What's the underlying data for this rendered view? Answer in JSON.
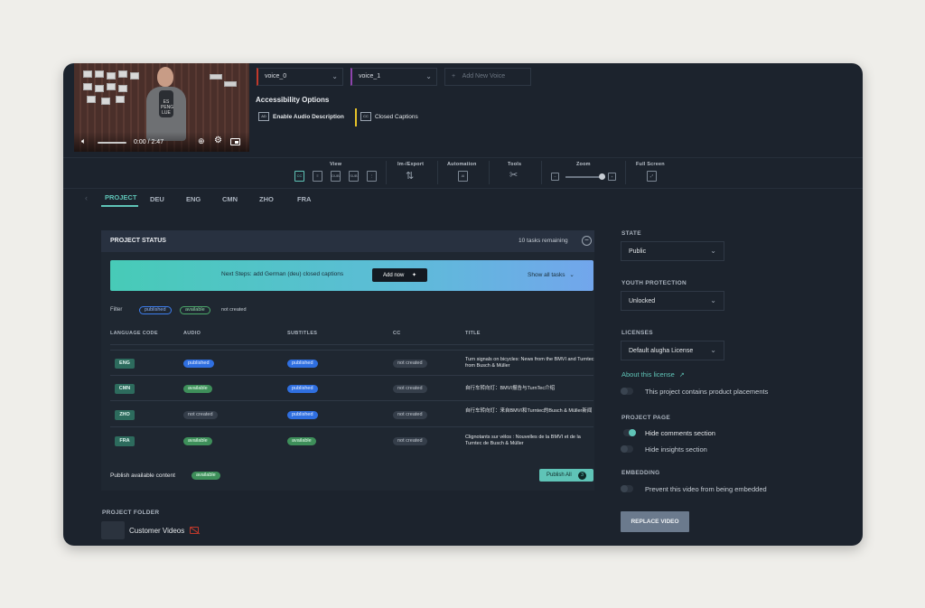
{
  "player": {
    "time": "0:00 / 2:47",
    "shirt_text": "ES\nPENG\nLUE"
  },
  "voices": {
    "voice_0": "voice_0",
    "voice_1": "voice_1",
    "add_new": "Add New Voice"
  },
  "accessibility": {
    "title": "Accessibility Options",
    "audio_desc_icon": "AD",
    "audio_desc": "Enable Audio Description",
    "cc_icon": "CC",
    "closed_captions": "Closed Captions"
  },
  "toolbar": {
    "view": "View",
    "export": "Im-/Export",
    "automation": "Automation",
    "tools": "Tools",
    "zoom": "Zoom",
    "fullscreen": "Full Screen",
    "view_icons": [
      "CC",
      "",
      "DUB",
      "SUB",
      ""
    ],
    "ai_icon": "AI",
    "zoom_level": 0.8
  },
  "tabs": [
    "PROJECT",
    "DEU",
    "ENG",
    "CMN",
    "ZHO",
    "FRA"
  ],
  "project_status": {
    "title": "PROJECT STATUS",
    "tasks": "10 tasks remaining",
    "next_steps": "Next Steps: add German (deu) closed captions",
    "add_now": "Add now",
    "show_all": "Show all tasks",
    "filter_label": "Filter",
    "filters": [
      "published",
      "available",
      "not created"
    ],
    "columns": [
      "LANGUAGE CODE",
      "AUDIO",
      "SUBTITLES",
      "CC",
      "TITLE"
    ],
    "rows": [
      {
        "code": "ENG",
        "audio": "published",
        "subtitles": "published",
        "cc": "not created",
        "title": "Turn signals on bicycles: News from the BMVI and Turntec from Busch & Müller"
      },
      {
        "code": "CMN",
        "audio": "available",
        "subtitles": "published",
        "cc": "not created",
        "title": "自行车转向灯：BMVI报告与TurnTec介绍"
      },
      {
        "code": "ZHO",
        "audio": "not created",
        "subtitles": "published",
        "cc": "not created",
        "title": "自行车转向灯：来自BMVI和Turntec的Busch & Müller新闻"
      },
      {
        "code": "FRA",
        "audio": "available",
        "subtitles": "available",
        "cc": "not created",
        "title": "Clignotants sur vélos : Nouvelles de la BMVI et de la Turntec de Busch & Müller"
      }
    ],
    "publish_label": "Publish available content",
    "publish_pill": "available",
    "publish_all": "Publish All",
    "publish_count": "3"
  },
  "folder": {
    "label": "PROJECT FOLDER",
    "name": "Customer Videos"
  },
  "sidebar": {
    "state_label": "STATE",
    "state_value": "Public",
    "youth_label": "YOUTH PROTECTION",
    "youth_value": "Unlocked",
    "licenses_label": "LICENSES",
    "licenses_value": "Default alugha License",
    "about_license": "About this license",
    "product_placements": "This project contains product placements",
    "project_page_label": "PROJECT PAGE",
    "hide_comments": "Hide comments section",
    "hide_insights": "Hide insights section",
    "embedding_label": "EMBEDDING",
    "prevent_embed": "Prevent this video from being embedded",
    "replace_video": "REPLACE VIDEO"
  },
  "colors": {
    "accent": "#5fc4b7",
    "published": "#2f6fe0",
    "available": "#3e8f5a",
    "background": "#1c232d"
  }
}
